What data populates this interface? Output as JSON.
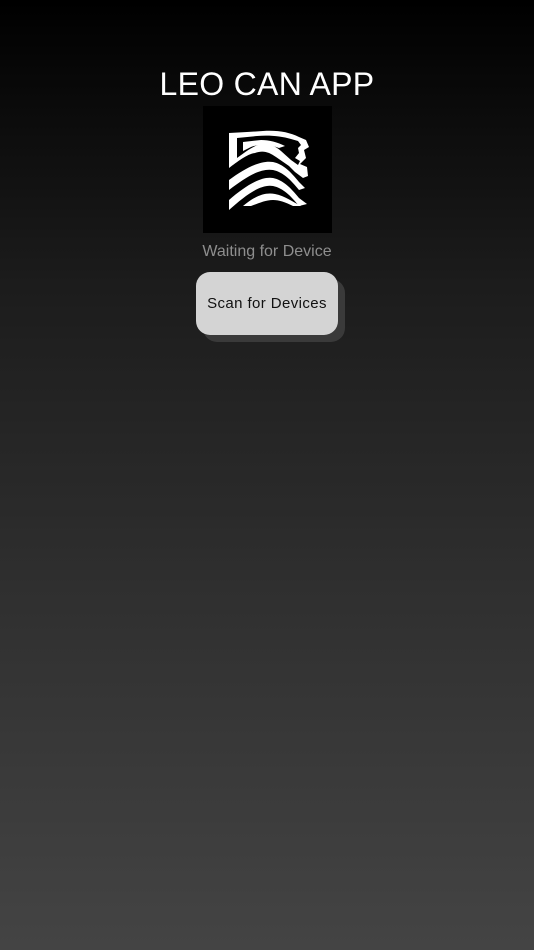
{
  "header": {
    "title": "LEO CAN APP"
  },
  "logo": {
    "icon": "lion-logo-icon",
    "background_color": "#000000",
    "stroke_color": "#ffffff"
  },
  "status": {
    "text": "Waiting for Device"
  },
  "actions": {
    "scan_label": "Scan for Devices"
  },
  "colors": {
    "background_top": "#000000",
    "background_bottom": "#444444",
    "button_bg": "#d4d4d4",
    "status_text": "#8e8e8e"
  }
}
